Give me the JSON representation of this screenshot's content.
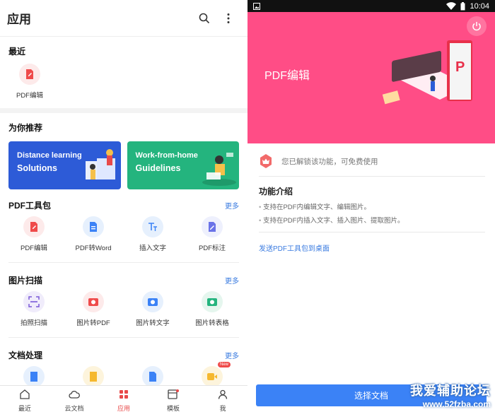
{
  "left": {
    "appbar": {
      "title": "应用"
    },
    "recent": {
      "heading": "最近",
      "items": [
        {
          "label": "PDF编辑",
          "icon": "pdf-edit-icon"
        }
      ]
    },
    "recommend": {
      "heading": "为你推荐",
      "banners": [
        {
          "line1": "Distance learning",
          "line2": "Solutions",
          "color": "#2d5bd7"
        },
        {
          "line1": "Work-from-home",
          "line2": "Guidelines",
          "color": "#24b47e"
        }
      ]
    },
    "pdf_tools": {
      "heading": "PDF工具包",
      "more": "更多",
      "items": [
        {
          "label": "PDF编辑",
          "icon": "pdf-edit-icon"
        },
        {
          "label": "PDF转Word",
          "icon": "pdf-to-word-icon"
        },
        {
          "label": "插入文字",
          "icon": "insert-text-icon"
        },
        {
          "label": "PDF标注",
          "icon": "pdf-annotate-icon"
        }
      ]
    },
    "image_scan": {
      "heading": "图片扫描",
      "more": "更多",
      "items": [
        {
          "label": "拍照扫描",
          "icon": "photo-scan-icon"
        },
        {
          "label": "图片转PDF",
          "icon": "image-to-pdf-icon"
        },
        {
          "label": "图片转文字",
          "icon": "image-to-text-icon"
        },
        {
          "label": "图片转表格",
          "icon": "image-to-table-icon"
        }
      ]
    },
    "doc_processing": {
      "heading": "文档处理",
      "more": "更多",
      "new_badge": "New"
    },
    "bottom_nav": [
      {
        "label": "最近",
        "icon": "home-icon"
      },
      {
        "label": "云文档",
        "icon": "cloud-icon"
      },
      {
        "label": "应用",
        "icon": "apps-icon"
      },
      {
        "label": "模板",
        "icon": "template-icon"
      },
      {
        "label": "我",
        "icon": "profile-icon"
      }
    ]
  },
  "right": {
    "status": {
      "time": "10:04"
    },
    "hero": {
      "title": "PDF编辑",
      "color": "#ff4d86"
    },
    "unlock_text": "您已解锁该功能，可免费使用",
    "intro": {
      "heading": "功能介绍",
      "lines": [
        "支持在PDF内编辑文字、编辑图片。",
        "支持在PDF内插入文字、插入图片、提取图片。"
      ]
    },
    "send_link": "发送PDF工具包到桌面",
    "select_button": "选择文档",
    "watermark": {
      "line1": "我爱辅助论坛",
      "line2": "www.52fzba.com"
    }
  }
}
